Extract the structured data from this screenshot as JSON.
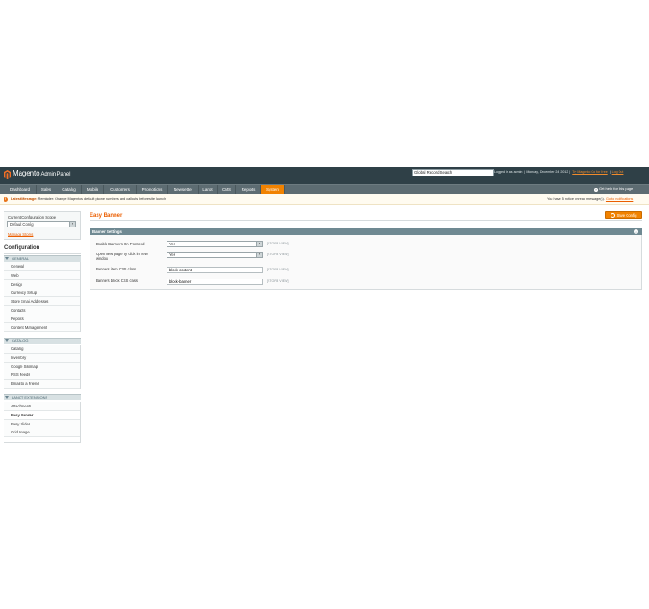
{
  "header": {
    "logo_text": "Magento",
    "logo_sub": "Admin Panel",
    "search_value": "Global Record Search",
    "logged_in": "Logged in as admin",
    "date": "Monday, December 24, 2012",
    "try_link": "Try Magento Go for Free",
    "logout": "Log Out",
    "help": "Get help for this page"
  },
  "nav": {
    "items": [
      {
        "label": "Dashboard"
      },
      {
        "label": "Sales"
      },
      {
        "label": "Catalog"
      },
      {
        "label": "Mobile"
      },
      {
        "label": "Customers"
      },
      {
        "label": "Promotions"
      },
      {
        "label": "Newsletter"
      },
      {
        "label": "Lanot"
      },
      {
        "label": "CMS"
      },
      {
        "label": "Reports"
      },
      {
        "label": "System"
      }
    ],
    "active": "System"
  },
  "message": {
    "icon": "!",
    "label": "Latest Message:",
    "text": "Reminder: Change Magento's default phone numbers and callouts before site launch",
    "right_text": "You have 5 notice unread message(s).",
    "right_link": "Go to notifications"
  },
  "sidebar": {
    "scope_label": "Current Configuration Scope:",
    "scope_value": "Default Config",
    "manage_stores": "Manage Stores",
    "config_title": "Configuration",
    "sections": [
      {
        "title": "General",
        "items": [
          "General",
          "Web",
          "Design",
          "Currency Setup",
          "Store Email Addresses",
          "Contacts",
          "Reports",
          "Content Management"
        ]
      },
      {
        "title": "Catalog",
        "items": [
          "Catalog",
          "Inventory",
          "Google Sitemap",
          "RSS Feeds",
          "Email to a Friend"
        ]
      },
      {
        "title": "Lanot Extensions",
        "items": [
          "Attachments",
          "Easy Banner",
          "Easy Slider",
          "Grid Image"
        ]
      }
    ],
    "active_item": "Easy Banner"
  },
  "main": {
    "title": "Easy Banner",
    "save_label": "Save Config",
    "fieldset_title": "Banner Settings",
    "fields": [
      {
        "label": "Enable Banners On Frontend",
        "value": "Yes",
        "scope": "[STORE VIEW]"
      },
      {
        "label": "Open new page by click in new window",
        "value": "Yes",
        "scope": "[STORE VIEW]"
      },
      {
        "label": "Banners item CSS class",
        "value": "block-content",
        "scope": "[STORE VIEW]"
      },
      {
        "label": "Banners block CSS class",
        "value": "block-banner",
        "scope": "[STORE VIEW]"
      }
    ]
  },
  "colors": {
    "header_bg": "#2f4047",
    "nav_bg": "#5d6c72",
    "accent": "#f18200",
    "link": "#eb5e00"
  }
}
